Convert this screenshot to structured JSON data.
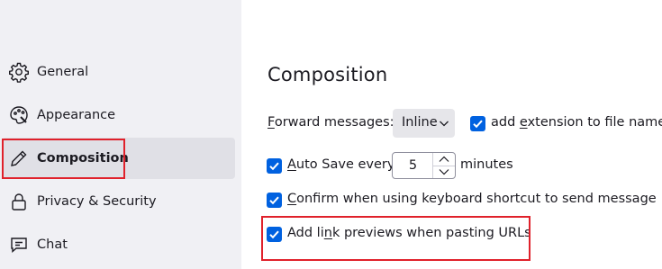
{
  "sidebar": {
    "items": [
      {
        "label": "General",
        "icon": "gear-icon",
        "selected": false
      },
      {
        "label": "Appearance",
        "icon": "palette-icon",
        "selected": false
      },
      {
        "label": "Composition",
        "icon": "pencil-icon",
        "selected": true
      },
      {
        "label": "Privacy & Security",
        "icon": "lock-icon",
        "selected": false
      },
      {
        "label": "Chat",
        "icon": "chat-icon",
        "selected": false
      }
    ]
  },
  "main": {
    "title": "Composition",
    "forward": {
      "label_pre": "",
      "label_key": "F",
      "label_post": "orward messages:",
      "dropdown_value": "Inline",
      "ext_checked": true,
      "ext_pre": "add ",
      "ext_key": "e",
      "ext_post": "xtension to file name"
    },
    "autosave": {
      "checked": true,
      "pre": "",
      "key": "A",
      "post": "uto Save every",
      "minutes_value": "5",
      "unit_label": "minutes"
    },
    "confirm": {
      "checked": true,
      "pre": "",
      "key": "C",
      "post": "onfirm when using keyboard shortcut to send message"
    },
    "link_previews": {
      "checked": true,
      "pre": "Add li",
      "key": "n",
      "post": "k previews when pasting URLs"
    }
  },
  "colors": {
    "accent": "#0061e0",
    "highlight": "#e0212b",
    "sidebar_bg": "#f0f0f4",
    "selected_bg": "#e0e0e6"
  }
}
